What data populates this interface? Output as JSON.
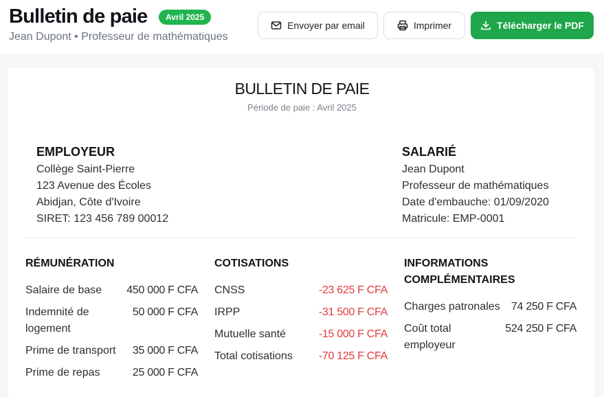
{
  "header": {
    "title": "Bulletin de paie",
    "badge": "Avril 2025",
    "subtitle": "Jean Dupont • Professeur de mathématiques",
    "actions": {
      "email": "Envoyer par email",
      "print": "Imprimer",
      "download": "Télécharger le PDF"
    },
    "colors": {
      "primary": "#1fa64a",
      "badge": "#22b44f",
      "negative": "#e23b3b"
    }
  },
  "document": {
    "title": "BULLETIN DE PAIE",
    "period": "Période de paie : Avril 2025",
    "employer": {
      "heading": "EMPLOYEUR",
      "lines": [
        "Collège Saint-Pierre",
        "123 Avenue des Écoles",
        "Abidjan, Côte d'Ivoire",
        "SIRET: 123 456 789 00012"
      ]
    },
    "employee": {
      "heading": "SALARIÉ",
      "lines": [
        "Jean Dupont",
        "Professeur de mathématiques",
        "Date d'embauche: 01/09/2020",
        "Matricule: EMP-0001"
      ]
    },
    "remuneration": {
      "heading": "RÉMUNÉRATION",
      "rows": [
        {
          "label": "Salaire de base",
          "value": "450 000 F CFA"
        },
        {
          "label": "Indemnité de logement",
          "value": "50 000 F CFA"
        },
        {
          "label": "Prime de transport",
          "value": "35 000 F CFA"
        },
        {
          "label": "Prime de repas",
          "value": "25 000 F CFA"
        }
      ]
    },
    "cotisations": {
      "heading": "COTISATIONS",
      "rows": [
        {
          "label": "CNSS",
          "value": "-23 625 F CFA"
        },
        {
          "label": "IRPP",
          "value": "-31 500 F CFA"
        },
        {
          "label": "Mutuelle santé",
          "value": "-15 000 F CFA"
        },
        {
          "label": "Total cotisations",
          "value": "-70 125 F CFA"
        }
      ]
    },
    "infos": {
      "heading": "INFORMATIONS COMPLÉMENTAIRES",
      "rows": [
        {
          "label": "Charges patronales",
          "value": "74 250 F CFA"
        },
        {
          "label": "Coût total employeur",
          "value": "524 250 F CFA"
        }
      ]
    }
  }
}
